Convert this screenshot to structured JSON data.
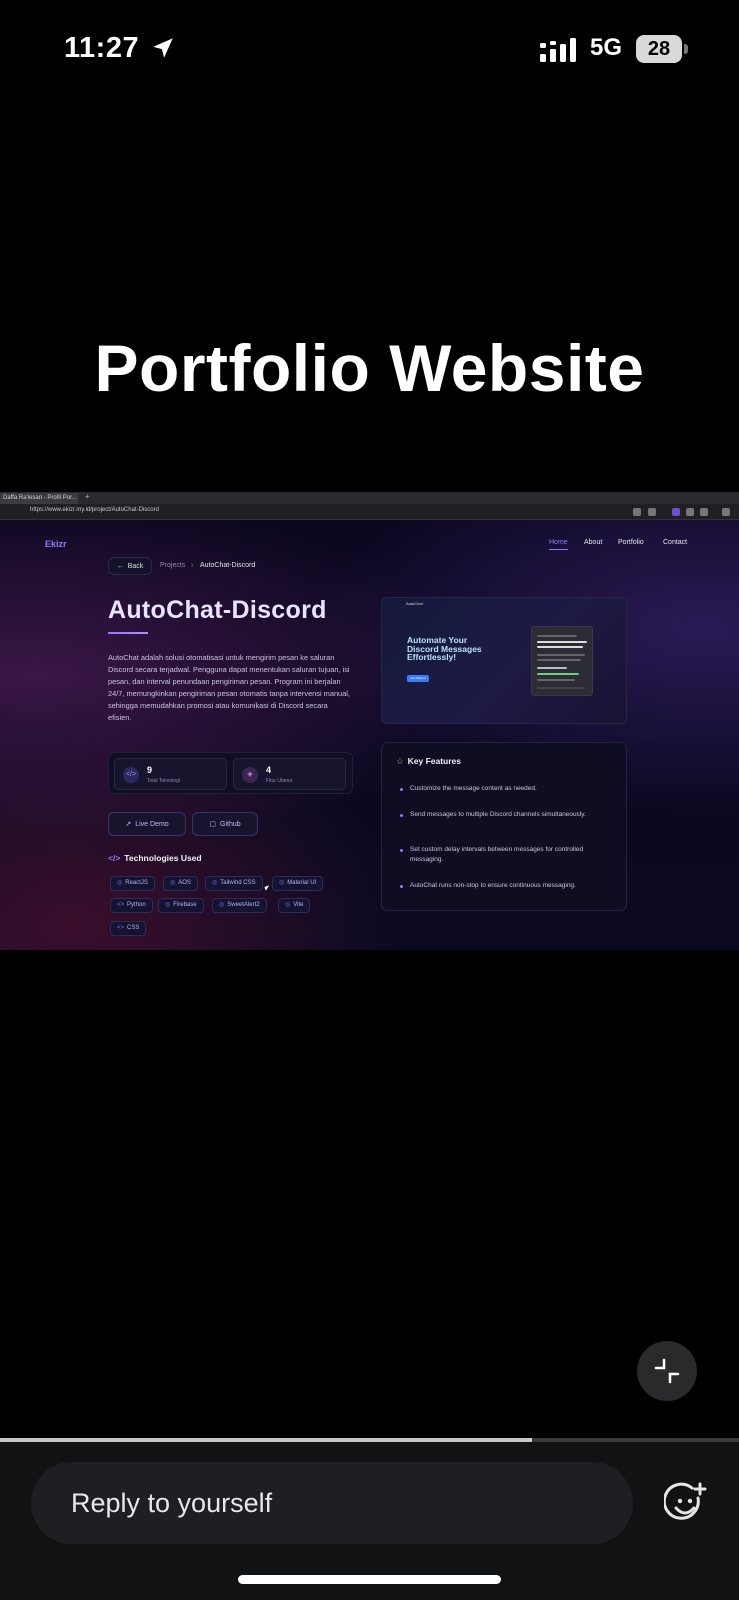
{
  "status_bar": {
    "time": "11:27",
    "network": "5G",
    "battery": "28"
  },
  "story": {
    "title": "Portfolio Website",
    "progress_fraction": 0.72
  },
  "browser": {
    "tab_title": "Daffa Ra'iesan - Profil Por...",
    "url": "https://www.ekizr.my.id/project/AutoChat-Discord"
  },
  "site": {
    "logo": "Ekizr",
    "nav": [
      "Home",
      "About",
      "Portfolio",
      "Contact"
    ],
    "back_label": "Back",
    "breadcrumb": {
      "parent": "Projects",
      "separator": "›",
      "current": "AutoChat-Discord"
    },
    "project_title": "AutoChat-Discord",
    "description": "AutoChat adalah solusi otomatisasi untuk mengirim pesan ke saluran Discord secara terjadwal. Pengguna dapat menentukan saluran tujuan, isi pesan, dan interval penundaan pengiriman pesan. Program ini berjalan 24/7, memungkinkan pengiriman pesan otomatis tanpa intervensi manual, sehingga memudahkan promosi atau komunikasi di Discord secara efisien.",
    "stats": [
      {
        "value": "9",
        "label": "Total Teknologi",
        "icon": "code-icon"
      },
      {
        "value": "4",
        "label": "Fitur Utama",
        "icon": "layers-icon"
      }
    ],
    "buttons": {
      "live_demo": "Live Demo",
      "github": "Github"
    },
    "tech_heading": "Technologies Used",
    "technologies": [
      "ReactJS",
      "AOS",
      "Tailwind CSS",
      "Material UI",
      "Python",
      "Firebase",
      "SweetAlert2",
      "Vite",
      "CSS"
    ],
    "preview": {
      "logo": "AutoChat",
      "headline": "Automate Your Discord Messages Effortlessly!",
      "button": "Get Started"
    },
    "features_heading": "Key Features",
    "features": [
      "Customize the message content as needed.",
      "Send messages to multiple Discord channels simultaneously.",
      "Set custom delay intervals between messages for controlled messaging.",
      "AutoChat runs non-stop to ensure continuous messaging."
    ]
  },
  "reply": {
    "placeholder": "Reply to yourself"
  },
  "colors": {
    "accent": "#8c7cff",
    "background": "#000000"
  }
}
